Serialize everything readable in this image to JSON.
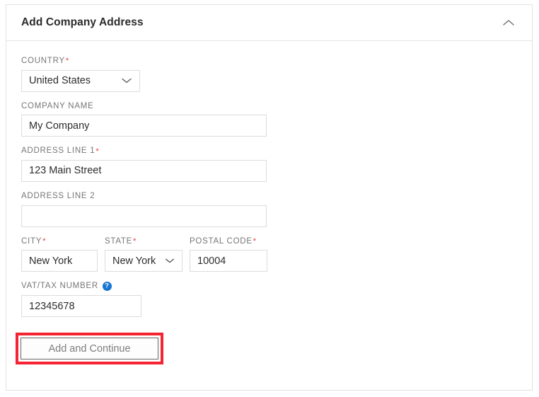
{
  "card": {
    "title": "Add Company Address",
    "collapse_icon": "chevron-up-icon"
  },
  "form": {
    "country": {
      "label": "COUNTRY",
      "required_marker": "*",
      "value": "United States",
      "chevron_icon": "chevron-down-icon"
    },
    "company_name": {
      "label": "COMPANY NAME",
      "value": "My Company",
      "placeholder": ""
    },
    "address_line_1": {
      "label": "ADDRESS LINE 1",
      "required_marker": "*",
      "value": "123 Main Street",
      "placeholder": ""
    },
    "address_line_2": {
      "label": "ADDRESS LINE 2",
      "value": "",
      "placeholder": ""
    },
    "city": {
      "label": "CITY",
      "required_marker": "*",
      "value": "New York",
      "placeholder": ""
    },
    "state": {
      "label": "STATE",
      "required_marker": "*",
      "value": "New York",
      "chevron_icon": "chevron-down-icon"
    },
    "postal_code": {
      "label": "POSTAL CODE",
      "required_marker": "*",
      "value": "10004",
      "placeholder": ""
    },
    "vat_tax_number": {
      "label": "VAT/TAX NUMBER",
      "help_icon": "question-mark-circle-icon",
      "help_glyph": "?",
      "value": "12345678",
      "placeholder": ""
    }
  },
  "actions": {
    "submit_label": "Add and Continue"
  },
  "colors": {
    "required_asterisk": "#e8383d",
    "help_icon_bg": "#1876d1",
    "highlight_border": "#f42432",
    "label_text": "#767676",
    "input_border": "#dcdcdc",
    "card_border": "#e2e2e2"
  }
}
